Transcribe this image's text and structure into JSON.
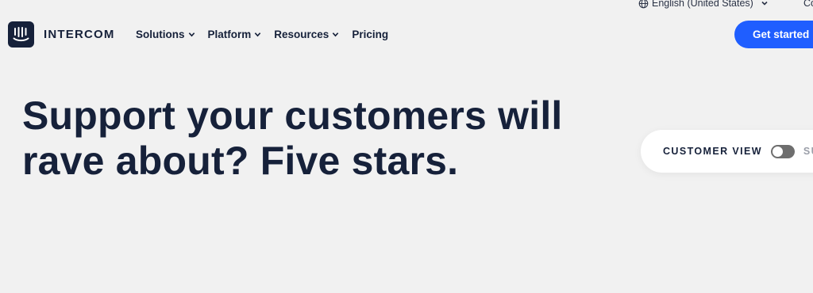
{
  "utility": {
    "language": "English (United States)",
    "contact_label_partial": "Co"
  },
  "header": {
    "logo_text": "INTERCOM",
    "nav": [
      {
        "label": "Solutions",
        "has_dropdown": true
      },
      {
        "label": "Platform",
        "has_dropdown": true
      },
      {
        "label": "Resources",
        "has_dropdown": true
      },
      {
        "label": "Pricing",
        "has_dropdown": false
      }
    ],
    "cta_label": "Get started"
  },
  "hero": {
    "title_line1": "Support your customers will",
    "title_line2": "rave about? Five stars."
  },
  "view_toggle": {
    "label": "CUSTOMER VIEW",
    "alt_label_partial": "SU",
    "toggle_on": false
  },
  "colors": {
    "background": "#f1f1f1",
    "text": "#16213a",
    "accent": "#1f5eff",
    "toggle_off": "#6e6e6e"
  },
  "icons": [
    "globe-icon",
    "chevron-down-icon",
    "intercom-logo-icon"
  ]
}
